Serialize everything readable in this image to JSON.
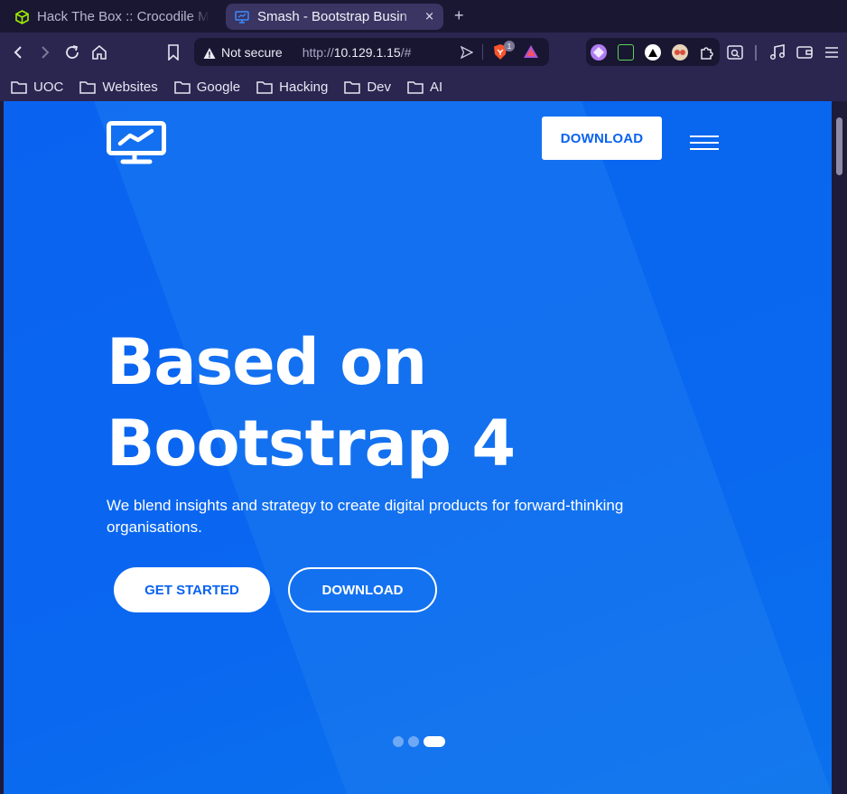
{
  "browser": {
    "tabs": [
      {
        "title": "Hack The Box :: Crocodile M",
        "favicon": "htb-cube-icon",
        "active": false
      },
      {
        "title": "Smash - Bootstrap Busin",
        "favicon": "monitor-icon",
        "active": true
      }
    ],
    "new_tab_label": "+",
    "close_tab_label": "×",
    "security_label": "Not secure",
    "url_prefix": "http://",
    "url_host": "10.129.1.15",
    "url_path": "/#",
    "shield_badge": "1",
    "bookmarks": [
      "UOC",
      "Websites",
      "Google",
      "Hacking",
      "Dev",
      "AI"
    ]
  },
  "page": {
    "nav_download": "DOWNLOAD",
    "hero_title_line1": "Based on",
    "hero_title_line2": "Bootstrap 4",
    "hero_subtitle": "We blend insights and strategy to create digital products for forward-thinking organisations.",
    "cta_primary": "GET STARTED",
    "cta_secondary": "DOWNLOAD",
    "slider_active_index": 3,
    "slider_count": 3
  },
  "colors": {
    "brand_blue": "#0a63f0",
    "browser_bg": "#2a2650",
    "tab_active": "#3a3563"
  }
}
